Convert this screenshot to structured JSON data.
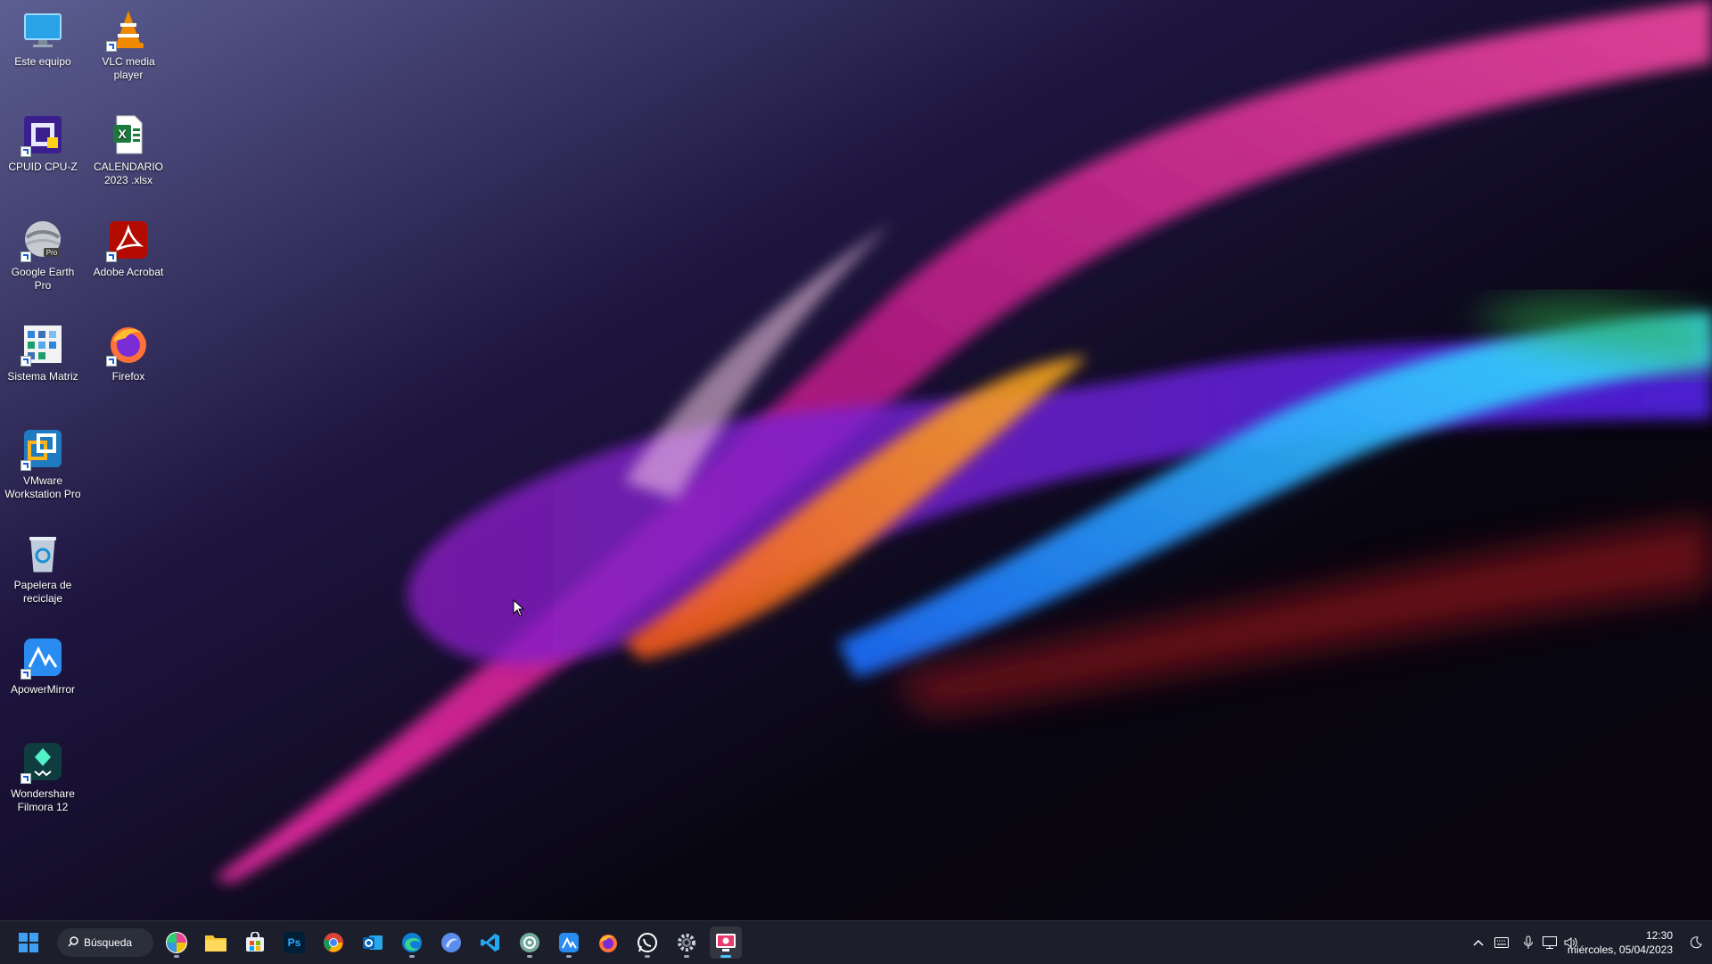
{
  "desktop": {
    "icons": [
      {
        "label": "Este equipo",
        "icon": "this-pc-icon"
      },
      {
        "label": "VLC media player",
        "icon": "vlc-icon"
      },
      {
        "label": "CPUID CPU-Z",
        "icon": "cpuz-icon"
      },
      {
        "label": "CALENDARIO 2023 .xlsx",
        "icon": "excel-file-icon"
      },
      {
        "label": "Google Earth Pro",
        "icon": "google-earth-icon"
      },
      {
        "label": "Adobe Acrobat",
        "icon": "acrobat-icon"
      },
      {
        "label": "Sistema Matriz",
        "icon": "sistema-matriz-icon"
      },
      {
        "label": "Firefox",
        "icon": "firefox-icon"
      },
      {
        "label": "VMware Workstation Pro",
        "icon": "vmware-icon"
      },
      {
        "label": "Papelera de reciclaje",
        "icon": "recycle-bin-icon"
      },
      {
        "label": "ApowerMirror",
        "icon": "apowermirror-icon"
      },
      {
        "label": "Wondershare Filmora 12",
        "icon": "filmora-icon"
      }
    ]
  },
  "taskbar": {
    "search_label": "Búsqueda",
    "apps": [
      {
        "name": "start-button",
        "icon": "windows-logo-icon"
      },
      {
        "name": "taskbar-app-pinwheel",
        "icon": "pinwheel-icon"
      },
      {
        "name": "taskbar-app-file-explorer",
        "icon": "folder-icon"
      },
      {
        "name": "taskbar-app-store",
        "icon": "store-icon"
      },
      {
        "name": "taskbar-app-photoshop",
        "icon": "photoshop-icon"
      },
      {
        "name": "taskbar-app-chrome",
        "icon": "chrome-icon"
      },
      {
        "name": "taskbar-app-outlook",
        "icon": "outlook-icon"
      },
      {
        "name": "taskbar-app-edge",
        "icon": "edge-icon"
      },
      {
        "name": "taskbar-app-browser",
        "icon": "browser-icon"
      },
      {
        "name": "taskbar-app-vscode",
        "icon": "vscode-icon"
      },
      {
        "name": "taskbar-app-chatgpt",
        "icon": "chatgpt-icon"
      },
      {
        "name": "taskbar-app-apowermirror",
        "icon": "apowermirror-icon"
      },
      {
        "name": "taskbar-app-firefox",
        "icon": "firefox-icon"
      },
      {
        "name": "taskbar-app-whatsapp",
        "icon": "whatsapp-icon"
      },
      {
        "name": "taskbar-app-settings",
        "icon": "gear-icon"
      },
      {
        "name": "taskbar-app-recorder",
        "icon": "screen-recorder-icon"
      }
    ],
    "ps_text": "Ps",
    "tray": {
      "time": "12:30",
      "date": "miércoles, 05/04/2023"
    }
  },
  "colors": {
    "taskbar_bg": "#1c1f2b",
    "accent": "#4cc2ff"
  }
}
